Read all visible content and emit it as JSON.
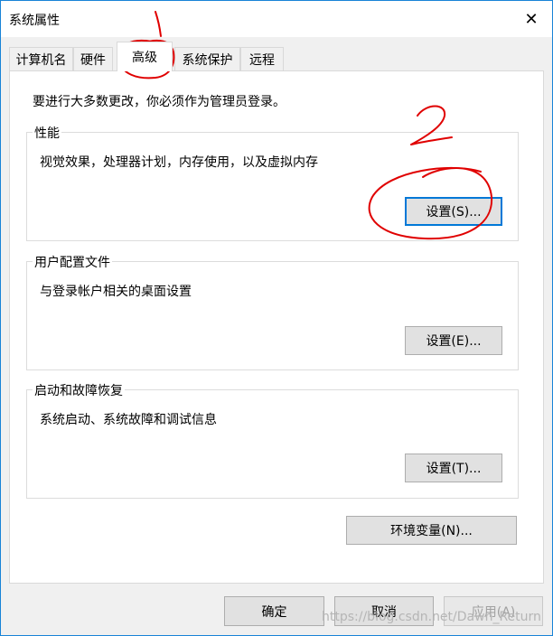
{
  "window": {
    "title": "系统属性",
    "close_glyph": "✕"
  },
  "tabs": [
    {
      "label": "计算机名"
    },
    {
      "label": "硬件"
    },
    {
      "label": "高级",
      "active": true
    },
    {
      "label": "系统保护"
    },
    {
      "label": "远程"
    }
  ],
  "notice": "要进行大多数更改，你必须作为管理员登录。",
  "groups": {
    "performance": {
      "title": "性能",
      "description": "视觉效果，处理器计划，内存使用，以及虚拟内存",
      "button": "设置(S)..."
    },
    "user_profiles": {
      "title": "用户配置文件",
      "description": "与登录帐户相关的桌面设置",
      "button": "设置(E)..."
    },
    "startup_recovery": {
      "title": "启动和故障恢复",
      "description": "系统启动、系统故障和调试信息",
      "button": "设置(T)..."
    }
  },
  "env_button": "环境变量(N)...",
  "footer": {
    "ok": "确定",
    "cancel": "取消",
    "apply": "应用(A)"
  },
  "watermark": "https://blog.csdn.net/Dawn_Return",
  "annotations": {
    "color": "#e00000",
    "marks": [
      "1",
      "2"
    ]
  }
}
